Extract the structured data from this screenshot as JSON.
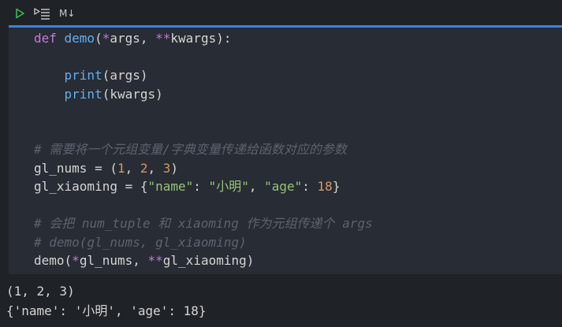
{
  "toolbar": {
    "run_icon": "play-icon",
    "run_all_icon": "run-below-icon",
    "markdown_label": "M↓",
    "accent_color": "#3b82e0",
    "run_color": "#3fb950"
  },
  "code": {
    "lines": [
      [
        {
          "t": "def ",
          "c": "kw"
        },
        {
          "t": "demo",
          "c": "fn"
        },
        {
          "t": "(",
          "c": "punc"
        },
        {
          "t": "*",
          "c": "op"
        },
        {
          "t": "args, ",
          "c": "var"
        },
        {
          "t": "**",
          "c": "op"
        },
        {
          "t": "kwargs):",
          "c": "var"
        }
      ],
      [],
      [
        {
          "t": "    ",
          "c": "var"
        },
        {
          "t": "print",
          "c": "fn"
        },
        {
          "t": "(args)",
          "c": "var"
        }
      ],
      [
        {
          "t": "    ",
          "c": "var"
        },
        {
          "t": "print",
          "c": "fn"
        },
        {
          "t": "(kwargs)",
          "c": "var"
        }
      ],
      [],
      [],
      [
        {
          "t": "# 需要将一个元组变量/字典变量传递给函数对应的参数",
          "c": "cmt"
        }
      ],
      [
        {
          "t": "gl_nums = (",
          "c": "var"
        },
        {
          "t": "1",
          "c": "num"
        },
        {
          "t": ", ",
          "c": "var"
        },
        {
          "t": "2",
          "c": "num"
        },
        {
          "t": ", ",
          "c": "var"
        },
        {
          "t": "3",
          "c": "num"
        },
        {
          "t": ")",
          "c": "var"
        }
      ],
      [
        {
          "t": "gl_xiaoming = {",
          "c": "var"
        },
        {
          "t": "\"name\"",
          "c": "str"
        },
        {
          "t": ": ",
          "c": "var"
        },
        {
          "t": "\"小明\"",
          "c": "str"
        },
        {
          "t": ", ",
          "c": "var"
        },
        {
          "t": "\"age\"",
          "c": "str"
        },
        {
          "t": ": ",
          "c": "var"
        },
        {
          "t": "18",
          "c": "num"
        },
        {
          "t": "}",
          "c": "var"
        }
      ],
      [],
      [
        {
          "t": "# 会把 num_tuple 和 xiaoming 作为元组传递个 args",
          "c": "cmt"
        }
      ],
      [
        {
          "t": "# demo(gl_nums, gl_xiaoming)",
          "c": "cmt"
        }
      ],
      [
        {
          "t": "demo(",
          "c": "var"
        },
        {
          "t": "*",
          "c": "op"
        },
        {
          "t": "gl_nums, ",
          "c": "var"
        },
        {
          "t": "**",
          "c": "op"
        },
        {
          "t": "gl_xiaoming)",
          "c": "var"
        }
      ]
    ]
  },
  "output": {
    "lines": [
      "(1, 2, 3)",
      "{'name': '小明', 'age': 18}"
    ]
  }
}
